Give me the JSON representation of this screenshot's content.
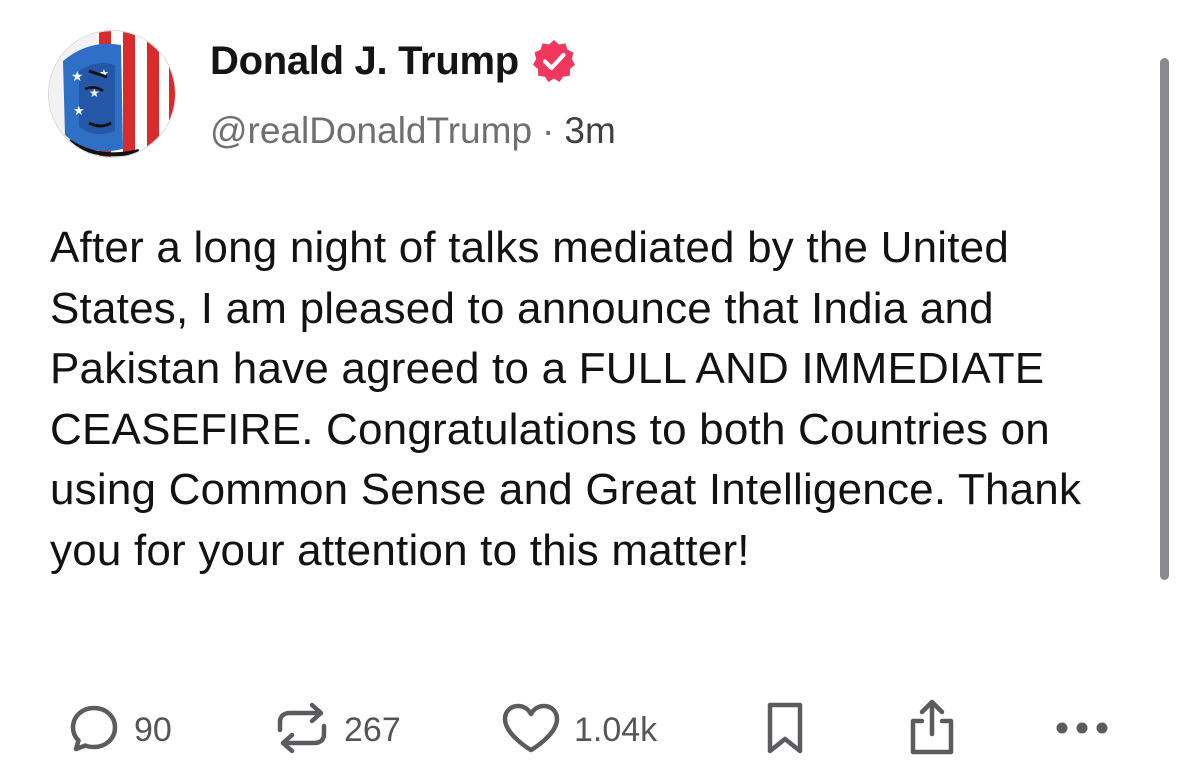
{
  "post": {
    "display_name": "Donald J. Trump",
    "verified_icon": "verified-badge-icon",
    "handle": "@realDonaldTrump",
    "separator": "·",
    "time": "3m",
    "avatar_icon": "profile-avatar",
    "text": "After a long night of talks mediated by the United States, I am pleased to announce that India and Pakistan have agreed to a FULL AND IMMEDIATE CEASEFIRE. Congratulations to both Countries on using Common Sense and Great Intelligence. Thank you for your attention to this matter!"
  },
  "actions": {
    "reply": {
      "icon": "reply-icon",
      "count": "90"
    },
    "repost": {
      "icon": "repost-icon",
      "count": "267"
    },
    "like": {
      "icon": "heart-icon",
      "count": "1.04k"
    },
    "bookmark": {
      "icon": "bookmark-icon"
    },
    "share": {
      "icon": "share-icon"
    },
    "more": {
      "icon": "more-options-icon"
    }
  },
  "colors": {
    "verified_badge": "#f1375e",
    "text_primary": "#121212",
    "text_secondary": "#6e6e73",
    "icon_gray": "#5b5b60"
  }
}
